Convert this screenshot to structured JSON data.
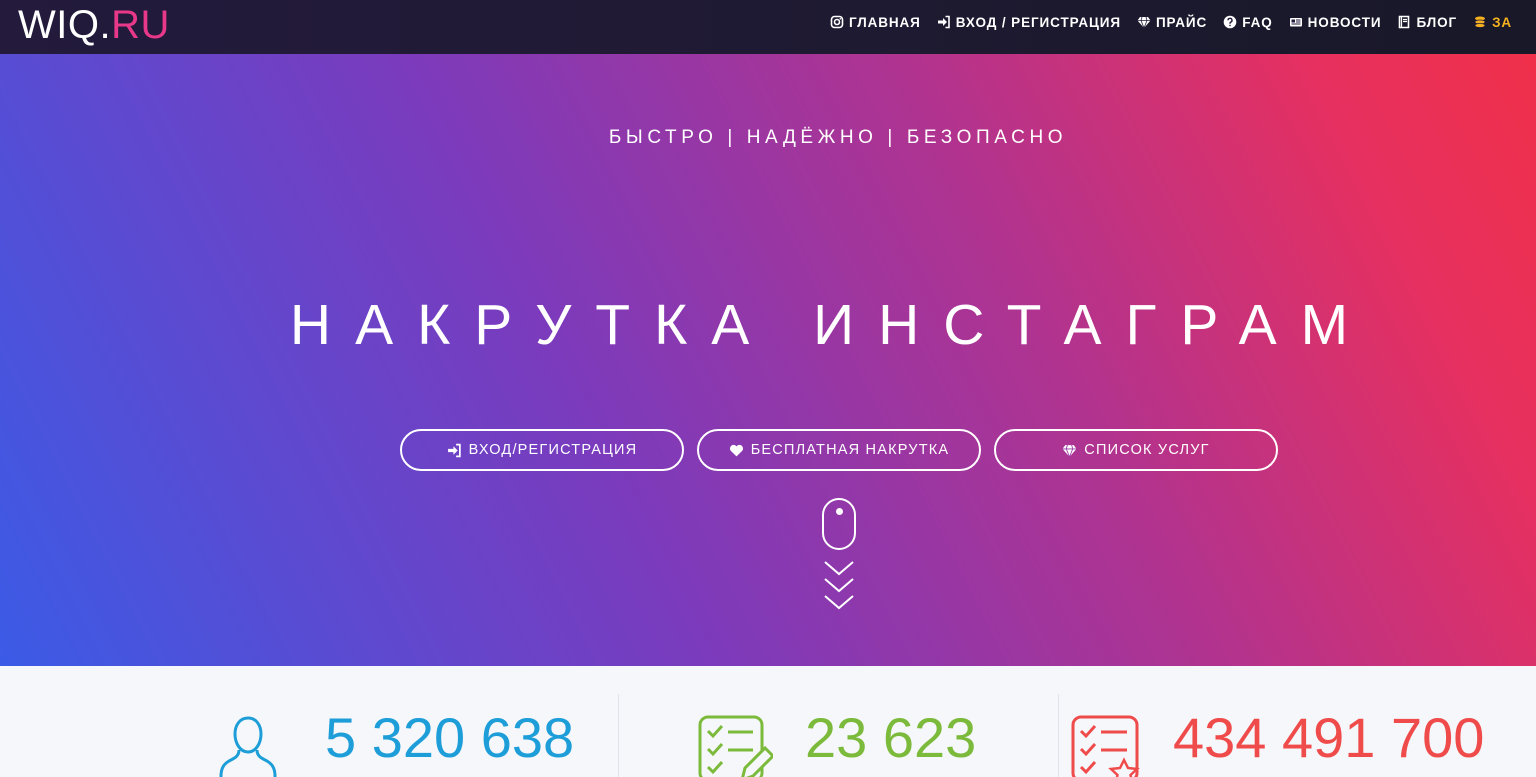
{
  "logo": {
    "part1": "WIQ.",
    "part2": "RU",
    "accent_color": "#e8388a"
  },
  "nav": {
    "items": [
      {
        "label": "ГЛАВНАЯ",
        "icon": "instagram-icon"
      },
      {
        "label": "ВХОД / РЕГИСТРАЦИЯ",
        "icon": "sign-in-icon"
      },
      {
        "label": "ПРАЙС",
        "icon": "diamond-icon"
      },
      {
        "label": "FAQ",
        "icon": "question-circle-icon"
      },
      {
        "label": "НОВОСТИ",
        "icon": "newspaper-icon"
      },
      {
        "label": "БЛОГ",
        "icon": "book-icon"
      },
      {
        "label": "ЗА",
        "icon": "coins-icon",
        "color": "#f5b01e"
      }
    ]
  },
  "hero": {
    "tagline": "БЫСТРО | НАДЁЖНО | БЕЗОПАСНО",
    "headline": "НАКРУТКА ИНСТАГРАМ",
    "buttons": {
      "login": {
        "label": "ВХОД/РЕГИСТРАЦИЯ",
        "icon": "sign-in-icon"
      },
      "free": {
        "label": "БЕСПЛАТНАЯ НАКРУТКА",
        "icon": "heart-icon"
      },
      "services": {
        "label": "СПИСОК УСЛУГ",
        "icon": "diamond-icon"
      }
    },
    "scroll_hint": {
      "icon": "mouse-icon",
      "arrows_icon": "triple-chevron-down-icon"
    },
    "gradient_colors": [
      "#3b5be6",
      "#7a3bbd",
      "#b1338f",
      "#e7305f",
      "#f0304a"
    ]
  },
  "stats": [
    {
      "value": "5 320 638",
      "icon": "user-icon",
      "color": "#1e9ed8"
    },
    {
      "value": "23 623",
      "icon": "checklist-pencil-icon",
      "color": "#7cba3c"
    },
    {
      "value": "434 491 700",
      "icon": "checklist-star-icon",
      "color": "#ef4b4b"
    }
  ]
}
